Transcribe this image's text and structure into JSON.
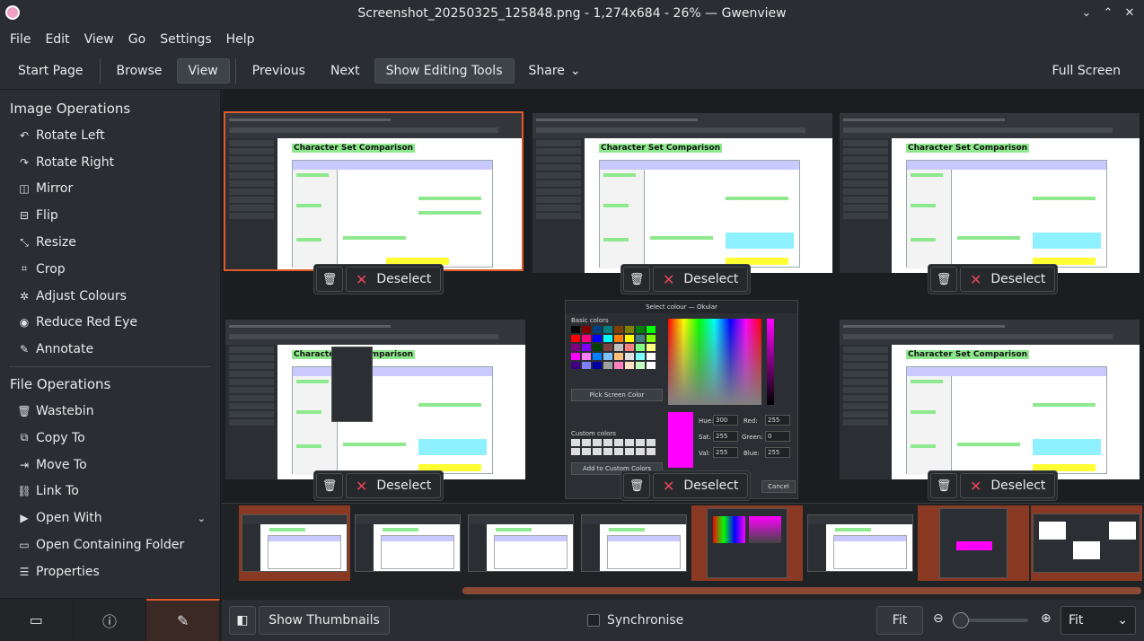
{
  "window": {
    "title": "Screenshot_20250325_125848.png - 1,274x684 - 26% — Gwenview",
    "controls": {
      "minimize": "⌄",
      "maximize": "⌃",
      "close": "✕"
    }
  },
  "menubar": [
    "File",
    "Edit",
    "View",
    "Go",
    "Settings",
    "Help"
  ],
  "toolbar": {
    "start_page": "Start Page",
    "browse": "Browse",
    "view": "View",
    "previous": "Previous",
    "next": "Next",
    "show_editing_tools": "Show Editing Tools",
    "share": "Share",
    "full_screen": "Full Screen"
  },
  "sidebar": {
    "image_ops_title": "Image Operations",
    "image_ops": [
      {
        "label": "Rotate Left",
        "icon": "rotate-left-icon"
      },
      {
        "label": "Rotate Right",
        "icon": "rotate-right-icon"
      },
      {
        "label": "Mirror",
        "icon": "mirror-icon"
      },
      {
        "label": "Flip",
        "icon": "flip-icon"
      },
      {
        "label": "Resize",
        "icon": "resize-icon"
      },
      {
        "label": "Crop",
        "icon": "crop-icon"
      },
      {
        "label": "Adjust Colours",
        "icon": "adjust-colours-icon"
      },
      {
        "label": "Reduce Red Eye",
        "icon": "red-eye-icon"
      },
      {
        "label": "Annotate",
        "icon": "annotate-icon"
      }
    ],
    "file_ops_title": "File Operations",
    "file_ops": [
      {
        "label": "Wastebin",
        "icon": "trash-icon"
      },
      {
        "label": "Copy To",
        "icon": "copy-icon"
      },
      {
        "label": "Move To",
        "icon": "move-icon"
      },
      {
        "label": "Link To",
        "icon": "link-icon"
      },
      {
        "label": "Open With",
        "icon": "open-with-icon"
      },
      {
        "label": "Open Containing Folder",
        "icon": "folder-icon"
      },
      {
        "label": "Properties",
        "icon": "properties-icon"
      }
    ]
  },
  "thumb_doc_title": "Character Set Comparison",
  "pills": {
    "deselect": "Deselect"
  },
  "dialog": {
    "title": "Select colour — Okular",
    "basic_colors": "Basic colors",
    "pick_screen": "Pick Screen Color",
    "custom_colors": "Custom colors",
    "add_custom": "Add to Custom Colors",
    "cancel": "Cancel",
    "hue_label": "Hue:",
    "hue": "300",
    "sat_label": "Sat:",
    "sat": "255",
    "val_label": "Val:",
    "val": "255",
    "red_label": "Red:",
    "red": "255",
    "green_label": "Green:",
    "green": "0",
    "blue_label": "Blue:",
    "blue": "255",
    "swatch_colors": [
      "#000000",
      "#800000",
      "#004080",
      "#008080",
      "#804000",
      "#808000",
      "#008000",
      "#00ff00",
      "#ff0000",
      "#ff0080",
      "#0000ff",
      "#00ffff",
      "#ff8000",
      "#ffff00",
      "#408080",
      "#80ff00",
      "#800080",
      "#8000ff",
      "#004000",
      "#804040",
      "#c0c0c0",
      "#ff8080",
      "#80ff80",
      "#ffff80",
      "#ff00ff",
      "#ff80ff",
      "#0080ff",
      "#80c0ff",
      "#ffc080",
      "#e0e0e0",
      "#80ffff",
      "#ffffff",
      "#400080",
      "#8080ff",
      "#0000a0",
      "#a0a0a0",
      "#ff80c0",
      "#ffe0c0",
      "#c0ffc0",
      "#ffffff"
    ]
  },
  "statusbar": {
    "show_thumbnails": "Show Thumbnails",
    "synchronise": "Synchronise",
    "fit": "Fit",
    "fit_select": "Fit",
    "zoom_level": 0
  },
  "colors": {
    "accent": "#e05a2a",
    "selected_bg": "#8a3a22"
  }
}
